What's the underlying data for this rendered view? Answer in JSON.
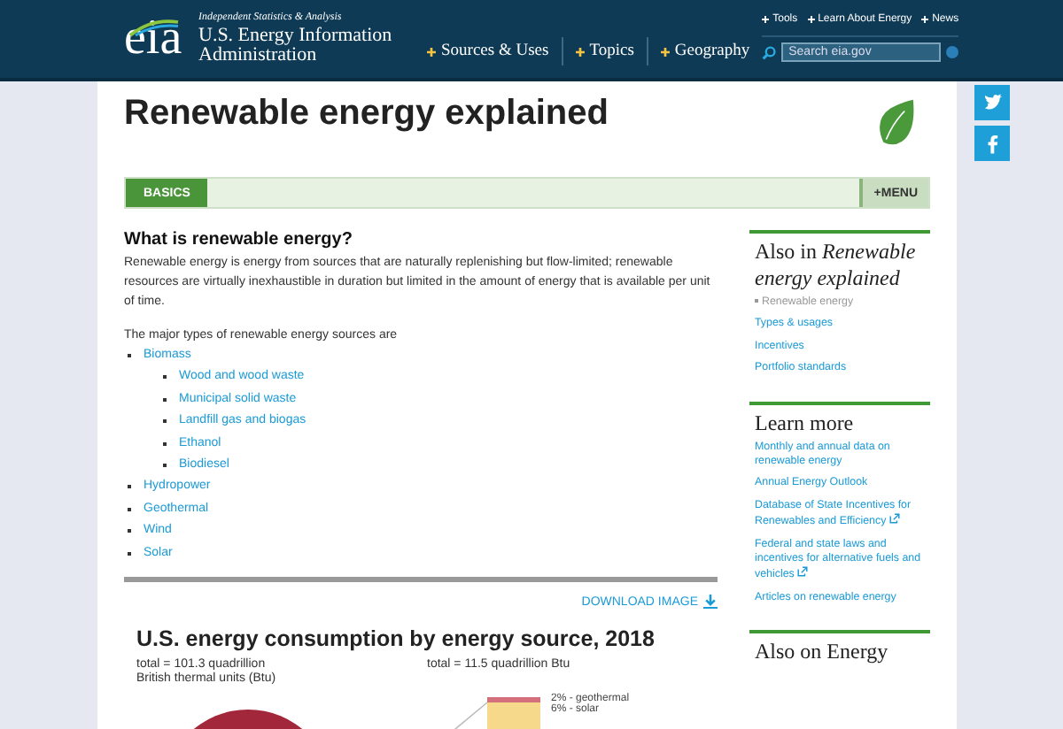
{
  "header": {
    "tagline": "Independent Statistics & Analysis",
    "agency": "U.S. Energy Information Administration",
    "logo": "eia",
    "nav": [
      "Sources & Uses",
      "Topics",
      "Geography"
    ],
    "top_links": [
      "Tools",
      "Learn About Energy",
      "News"
    ],
    "search": {
      "placeholder": "Search eia.gov"
    }
  },
  "page_title": "Renewable energy explained",
  "tabs": [
    {
      "label": "BASICS",
      "selected": true
    }
  ],
  "menu_button": "+MENU",
  "article": {
    "heading": "What is renewable energy?",
    "paragraph": "Renewable energy is energy from sources that are naturally replenishing but flow-limited; renewable resources are virtually inexhaustible in duration but limited in the amount of energy that is available per unit of time.",
    "intro": "The major types of renewable energy sources are",
    "sources": [
      {
        "label": "Biomass",
        "children": [
          {
            "label": "Wood and wood waste"
          },
          {
            "label": "Municipal solid waste"
          },
          {
            "label": "Landfill gas and biogas"
          },
          {
            "label": "Ethanol"
          },
          {
            "label": "Biodiesel"
          }
        ]
      },
      {
        "label": "Hydropower"
      },
      {
        "label": "Geothermal"
      },
      {
        "label": "Wind"
      },
      {
        "label": "Solar"
      }
    ]
  },
  "download": "DOWNLOAD IMAGE",
  "figure": {
    "title": "U.S. energy consumption by energy source, 2018",
    "total_left": "total = 101.3 quadrillion British thermal units (Btu)",
    "total_right": "total = 11.5 quadrillion Btu",
    "bar_labels": [
      {
        "text": "2% - geothermal",
        "color": "#d4707c"
      },
      {
        "text": "6% - solar",
        "color": "#f6d98a"
      }
    ]
  },
  "sidebar": [
    {
      "heading": "Also in *Renewable energy explained*",
      "links": [
        {
          "label": "Renewable energy",
          "selected": true,
          "external": false
        },
        {
          "label": "Types & usages",
          "selected": false,
          "external": false
        },
        {
          "label": "Incentives",
          "selected": false,
          "external": false
        },
        {
          "label": "Portfolio standards",
          "selected": false,
          "external": false
        }
      ]
    },
    {
      "heading": "Learn more",
      "links": [
        {
          "label": "Monthly and annual data on renewable energy",
          "selected": false,
          "external": false
        },
        {
          "label": "Annual Energy Outlook",
          "selected": false,
          "external": false
        },
        {
          "label": "Database of State Incentives for Renewables and Efficiency",
          "selected": false,
          "external": true
        },
        {
          "label": "Federal and state laws and incentives for alternative fuels and vehicles",
          "selected": false,
          "external": true
        },
        {
          "label": "Articles on renewable energy",
          "selected": false,
          "external": false
        }
      ]
    },
    {
      "heading": "Also on Energy"
    }
  ],
  "social": [
    {
      "kind": "twitter"
    },
    {
      "kind": "facebook"
    }
  ]
}
